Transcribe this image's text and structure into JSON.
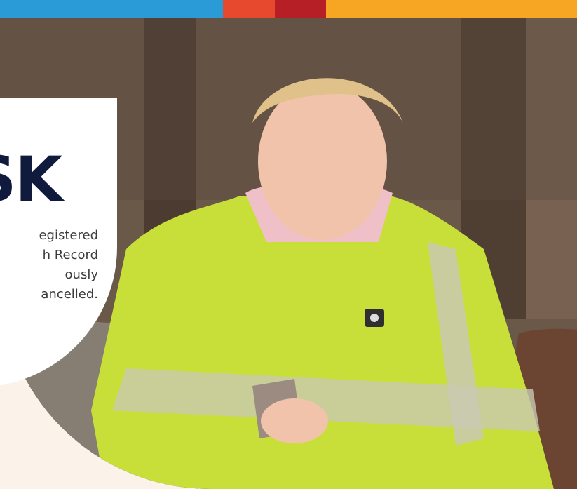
{
  "brand_stripe": {
    "colors": [
      "#2b9bd7",
      "#e6492d",
      "#b71f27",
      "#f6a623"
    ]
  },
  "hero": {
    "heading": "SK",
    "body_lines": [
      "egistered",
      "h Record",
      "ously",
      "ancelled."
    ]
  },
  "image": {
    "subject": "woman-in-hi-vis-jacket-using-phone",
    "icons": [
      "sunglasses-icon",
      "phone-icon",
      "jacket-badge-icon"
    ]
  }
}
